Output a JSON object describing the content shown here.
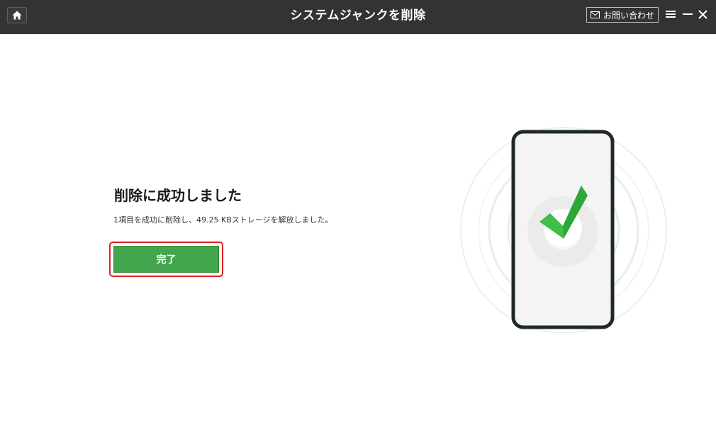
{
  "window": {
    "title": "システムジャンクを削除"
  },
  "toolbar": {
    "contact_label": "お問い合わせ",
    "home_icon": "home-icon",
    "mail_icon": "mail-icon",
    "menu_icon": "hamburger-menu-icon",
    "minimize_icon": "minimize-icon",
    "close_icon": "close-icon"
  },
  "main": {
    "heading": "削除に成功しました",
    "description": "1項目を成功に削除し、49.25 KBストレージを解放しました。",
    "done_label": "完了"
  },
  "illustration": {
    "phone_icon": "phone-icon",
    "check_icon": "checkmark-icon"
  },
  "colors": {
    "titlebar": "#333333",
    "accent_green": "#43a54c",
    "highlight_red": "#e02020",
    "phone_frame": "#1f2a22"
  }
}
